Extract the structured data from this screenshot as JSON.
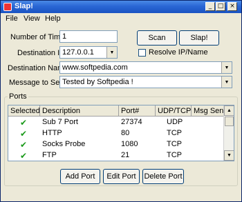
{
  "window": {
    "title": "Slap!"
  },
  "menu": [
    "File",
    "View",
    "Help"
  ],
  "form": {
    "times_label": "Number of Times:",
    "times_value": "1",
    "ip_label": "Destination IP:",
    "ip_value": "127.0.0.1",
    "name_label": "Destination Name:",
    "name_value": "www.softpedia.com",
    "message_label": "Message to Send:",
    "message_value": "Tested by Softpedia !",
    "resolve_label": "Resolve IP/Name",
    "scan_label": "Scan",
    "slap_label": "Slap!"
  },
  "ports": {
    "group_title": "Ports",
    "columns": [
      "Selected",
      "Description",
      "Port#",
      "UDP/TCP",
      "Msg Sent"
    ],
    "rows": [
      {
        "description": "Sub 7 Port",
        "port": "27374",
        "proto": "UDP",
        "msg_sent": ""
      },
      {
        "description": "HTTP",
        "port": "80",
        "proto": "TCP",
        "msg_sent": ""
      },
      {
        "description": "Socks Probe",
        "port": "1080",
        "proto": "TCP",
        "msg_sent": ""
      },
      {
        "description": "FTP",
        "port": "21",
        "proto": "TCP",
        "msg_sent": ""
      }
    ],
    "check_glyph": "✔",
    "add_label": "Add Port",
    "edit_label": "Edit Port",
    "delete_label": "Delete Port"
  }
}
